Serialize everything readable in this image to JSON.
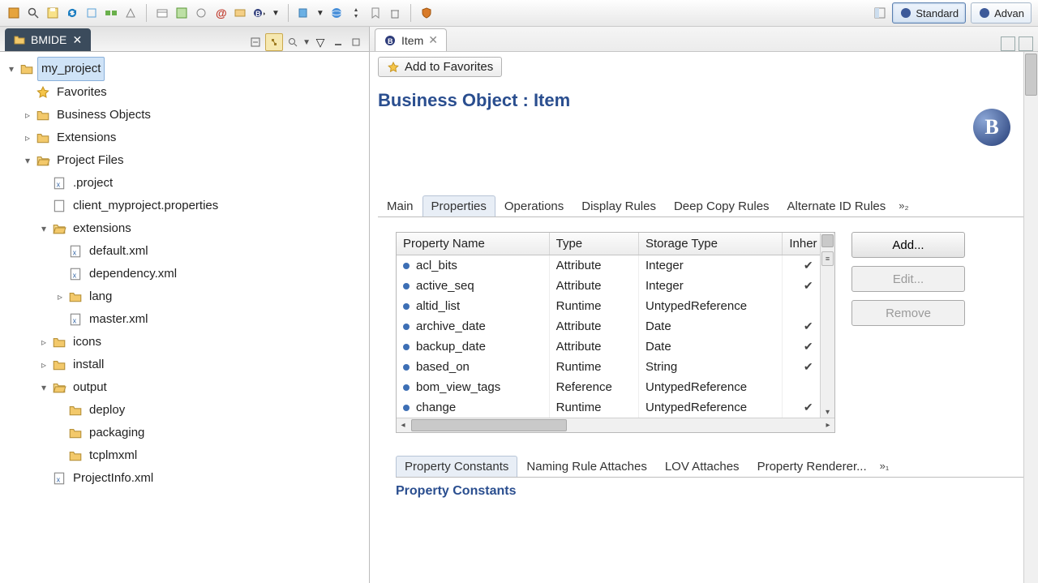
{
  "perspectives": {
    "standard": "Standard",
    "advanced": "Advan"
  },
  "leftView": {
    "title": "BMIDE"
  },
  "tree": {
    "root": "my_project",
    "favorites": "Favorites",
    "business_objects": "Business Objects",
    "extensions_top": "Extensions",
    "project_files": "Project Files",
    "project_file": ".project",
    "client_props": "client_myproject.properties",
    "extensions_folder": "extensions",
    "default_xml": "default.xml",
    "dependency_xml": "dependency.xml",
    "lang": "lang",
    "master_xml": "master.xml",
    "icons": "icons",
    "install": "install",
    "output": "output",
    "deploy": "deploy",
    "packaging": "packaging",
    "tcplmxml": "tcplmxml",
    "projectinfo": "ProjectInfo.xml"
  },
  "editor": {
    "tab": "Item",
    "addFavorites": "Add to Favorites",
    "title": "Business Object : Item"
  },
  "tabs": {
    "main": "Main",
    "properties": "Properties",
    "operations": "Operations",
    "displayRules": "Display Rules",
    "deepCopy": "Deep Copy Rules",
    "altId": "Alternate ID Rules",
    "more": "»₂"
  },
  "propTable": {
    "headers": {
      "name": "Property Name",
      "type": "Type",
      "storage": "Storage Type",
      "inherited": "Inher"
    },
    "rows": [
      {
        "name": "acl_bits",
        "type": "Attribute",
        "storage": "Integer",
        "inh": true
      },
      {
        "name": "active_seq",
        "type": "Attribute",
        "storage": "Integer",
        "inh": true
      },
      {
        "name": "altid_list",
        "type": "Runtime",
        "storage": "UntypedReference",
        "inh": false
      },
      {
        "name": "archive_date",
        "type": "Attribute",
        "storage": "Date",
        "inh": true
      },
      {
        "name": "backup_date",
        "type": "Attribute",
        "storage": "Date",
        "inh": true
      },
      {
        "name": "based_on",
        "type": "Runtime",
        "storage": "String",
        "inh": true
      },
      {
        "name": "bom_view_tags",
        "type": "Reference",
        "storage": "UntypedReference",
        "inh": false
      },
      {
        "name": "change",
        "type": "Runtime",
        "storage": "UntypedReference",
        "inh": true
      }
    ]
  },
  "buttons": {
    "add": "Add...",
    "edit": "Edit...",
    "remove": "Remove"
  },
  "lowerTabs": {
    "propConstants": "Property Constants",
    "namingRule": "Naming Rule Attaches",
    "lov": "LOV Attaches",
    "renderer": "Property Renderer...",
    "more": "»₁"
  },
  "lowerTitle": "Property Constants"
}
